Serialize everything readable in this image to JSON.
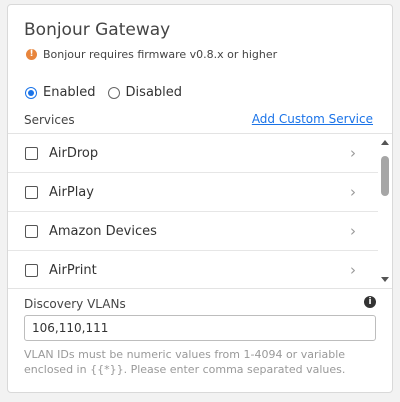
{
  "title": "Bonjour Gateway",
  "warning": {
    "icon": "exclamation-icon",
    "text": "Bonjour requires firmware v0.8.x or higher"
  },
  "mode": {
    "options": [
      {
        "label": "Enabled",
        "selected": true
      },
      {
        "label": "Disabled",
        "selected": false
      }
    ]
  },
  "services": {
    "label": "Services",
    "add_link": "Add Custom Service",
    "items": [
      {
        "label": "AirDrop",
        "checked": false
      },
      {
        "label": "AirPlay",
        "checked": false
      },
      {
        "label": "Amazon Devices",
        "checked": false
      },
      {
        "label": "AirPrint",
        "checked": false
      }
    ]
  },
  "discovery": {
    "label": "Discovery VLANs",
    "value": "106,110,111",
    "hint": "VLAN IDs must be numeric values from 1-4094 or variable enclosed in {{*}}. Please enter comma separated values."
  },
  "colors": {
    "accent": "#1a73e8",
    "warning": "#e8853c",
    "hint": "#999999"
  }
}
